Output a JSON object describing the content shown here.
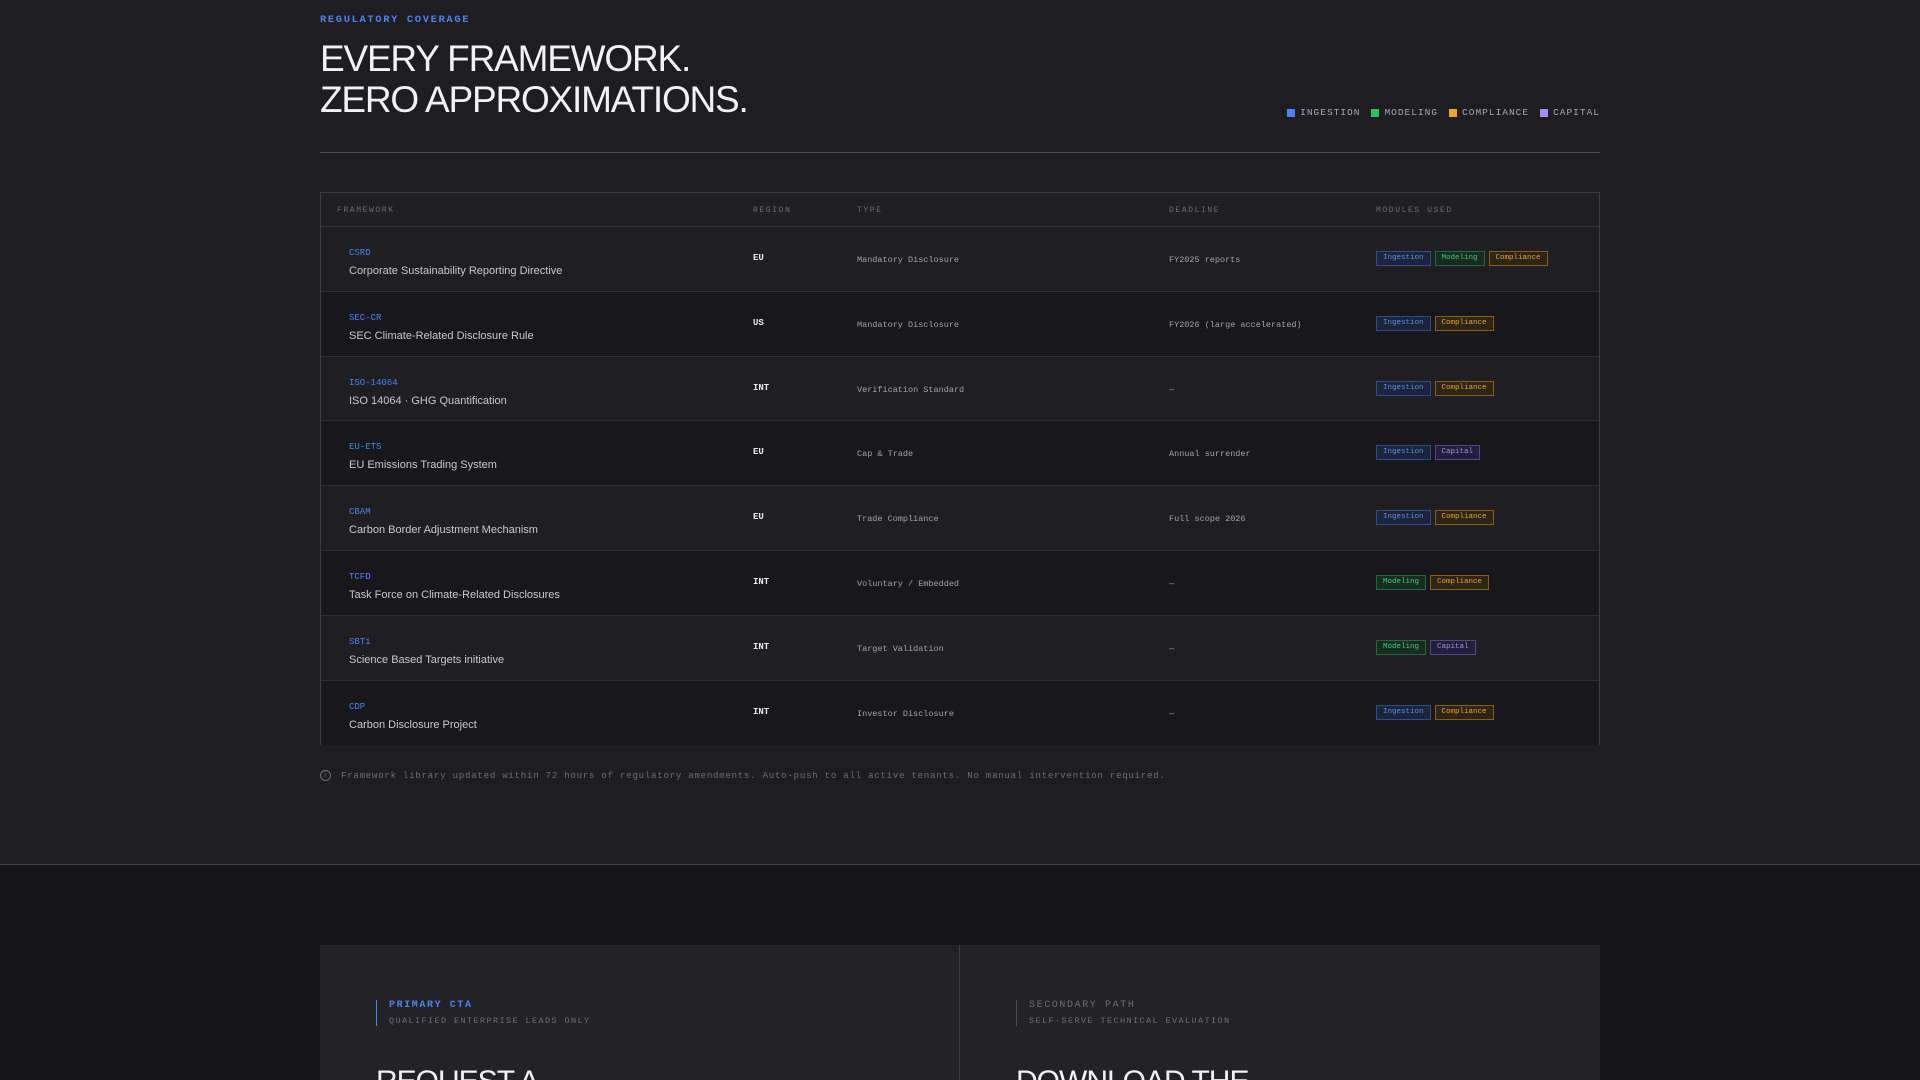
{
  "section": {
    "eyebrow": "REGULATORY COVERAGE",
    "headline_line1": "EVERY FRAMEWORK.",
    "headline_line2": "ZERO APPROXIMATIONS."
  },
  "legend": [
    {
      "label": "INGESTION",
      "color": "#4d82f0"
    },
    {
      "label": "MODELING",
      "color": "#2fbf6a"
    },
    {
      "label": "COMPLIANCE",
      "color": "#f0a428"
    },
    {
      "label": "CAPITAL",
      "color": "#a58cf0"
    }
  ],
  "table": {
    "headers": {
      "framework": "FRAMEWORK",
      "region": "REGION",
      "type": "TYPE",
      "deadline": "DEADLINE",
      "modules": "MODULES USED"
    },
    "rows": [
      {
        "code": "CSRD",
        "name": "Corporate Sustainability Reporting Directive",
        "region": "EU",
        "type": "Mandatory Disclosure",
        "deadline": "FY2025 reports",
        "modules": [
          "Ingestion",
          "Modeling",
          "Compliance"
        ]
      },
      {
        "code": "SEC-CR",
        "name": "SEC Climate-Related Disclosure Rule",
        "region": "US",
        "type": "Mandatory Disclosure",
        "deadline": "FY2026 (large accelerated)",
        "modules": [
          "Ingestion",
          "Compliance"
        ]
      },
      {
        "code": "ISO-14064",
        "name": "ISO 14064 · GHG Quantification",
        "region": "INT",
        "type": "Verification Standard",
        "deadline": "—",
        "modules": [
          "Ingestion",
          "Compliance"
        ]
      },
      {
        "code": "EU-ETS",
        "name": "EU Emissions Trading System",
        "region": "EU",
        "type": "Cap & Trade",
        "deadline": "Annual surrender",
        "modules": [
          "Ingestion",
          "Capital"
        ]
      },
      {
        "code": "CBAM",
        "name": "Carbon Border Adjustment Mechanism",
        "region": "EU",
        "type": "Trade Compliance",
        "deadline": "Full scope 2026",
        "modules": [
          "Ingestion",
          "Compliance"
        ]
      },
      {
        "code": "TCFD",
        "name": "Task Force on Climate-Related Disclosures",
        "region": "INT",
        "type": "Voluntary / Embedded",
        "deadline": "—",
        "modules": [
          "Modeling",
          "Compliance"
        ]
      },
      {
        "code": "SBTi",
        "name": "Science Based Targets initiative",
        "region": "INT",
        "type": "Target Validation",
        "deadline": "—",
        "modules": [
          "Modeling",
          "Capital"
        ]
      },
      {
        "code": "CDP",
        "name": "Carbon Disclosure Project",
        "region": "INT",
        "type": "Investor Disclosure",
        "deadline": "—",
        "modules": [
          "Ingestion",
          "Compliance"
        ]
      }
    ]
  },
  "footnote": "Framework library updated within 72 hours of regulatory amendments. Auto-push to all active tenants. No manual intervention required.",
  "cta": {
    "primary": {
      "kicker": "PRIMARY CTA",
      "sub": "QUALIFIED ENTERPRISE LEADS ONLY",
      "heading": "REQUEST A"
    },
    "secondary": {
      "kicker": "SECONDARY PATH",
      "sub": "SELF-SERVE TECHNICAL EVALUATION",
      "heading": "DOWNLOAD THE"
    }
  }
}
